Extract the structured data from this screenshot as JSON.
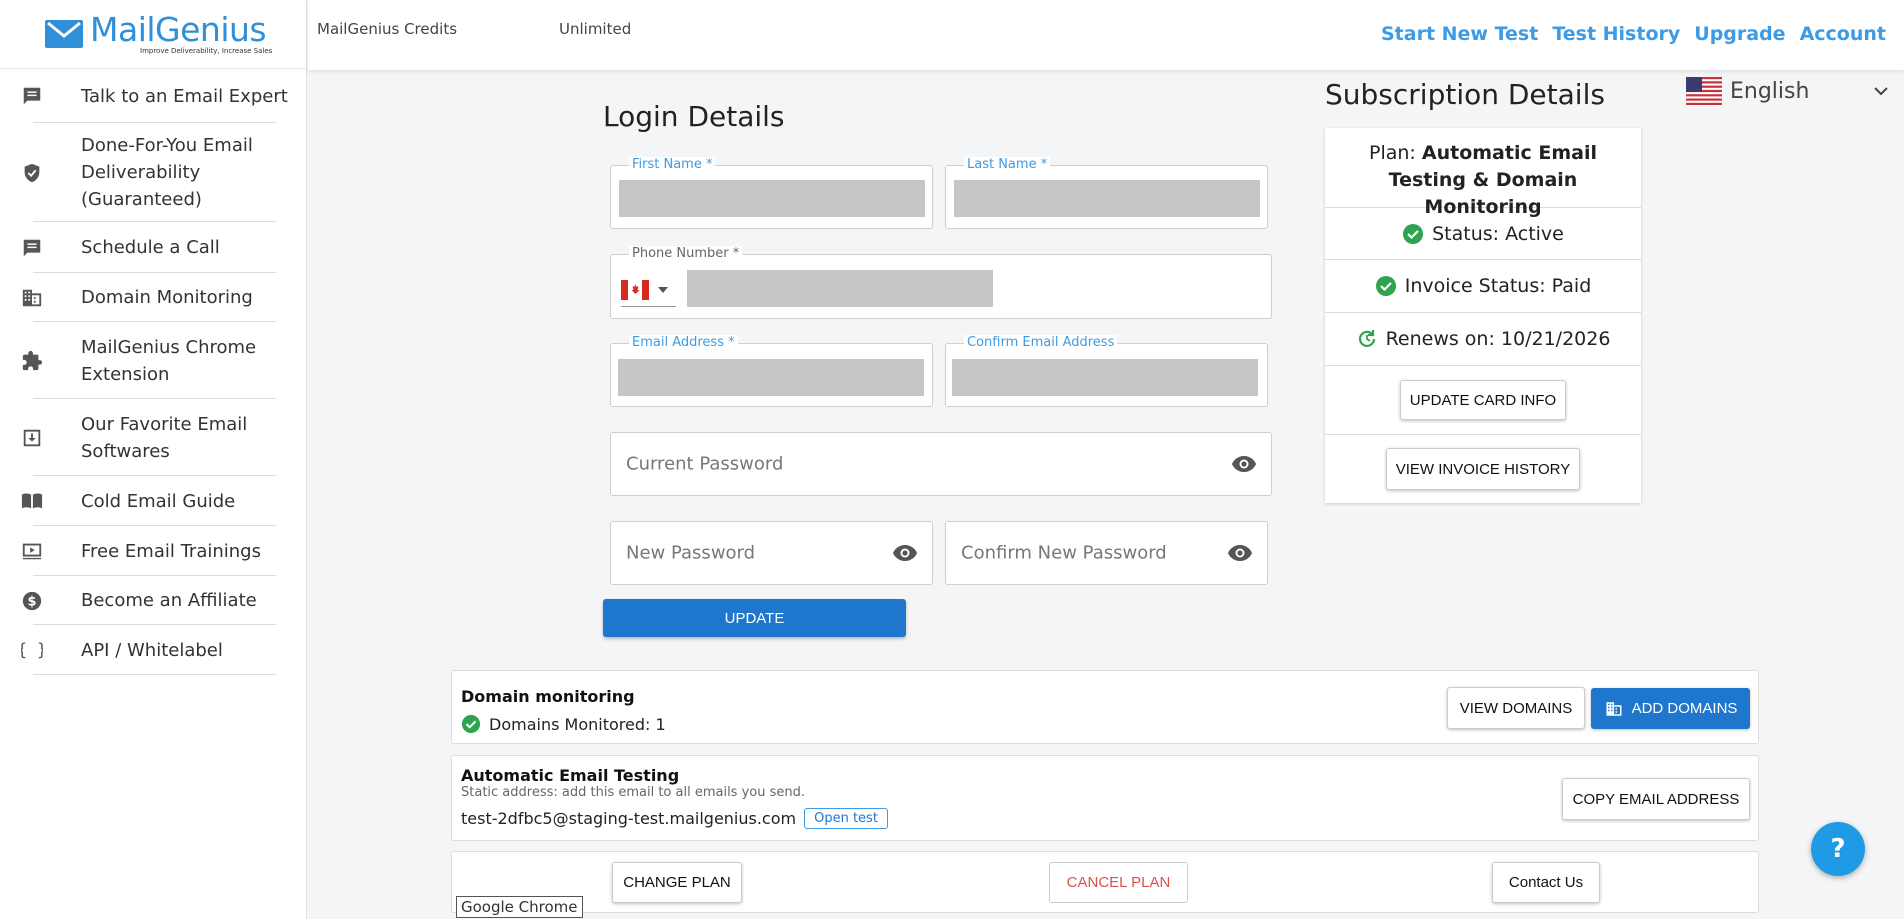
{
  "brand": {
    "name": "MailGenius",
    "tagline": "Improve Deliverability, Increase Sales",
    "color": "#2f8fd9"
  },
  "sidebar": {
    "items": [
      {
        "label": "Talk to an Email Expert",
        "icon": "chat-icon"
      },
      {
        "label": "Done-For-You Email Deliverability (Guaranteed)",
        "icon": "shield-check-icon"
      },
      {
        "label": "Schedule a Call",
        "icon": "chat-icon"
      },
      {
        "label": "Domain Monitoring",
        "icon": "building-icon"
      },
      {
        "label": "MailGenius Chrome Extension",
        "icon": "puzzle-icon"
      },
      {
        "label": "Our Favorite Email Softwares",
        "icon": "download-box-icon"
      },
      {
        "label": "Cold Email Guide",
        "icon": "book-icon"
      },
      {
        "label": "Free Email Trainings",
        "icon": "video-icon"
      },
      {
        "label": "Become an Affiliate",
        "icon": "dollar-icon"
      },
      {
        "label": "API / Whitelabel",
        "icon": "braces-icon"
      }
    ]
  },
  "topbar": {
    "credits_label": "MailGenius Credits",
    "credits_value": "Unlimited",
    "nav": [
      "Start New Test",
      "Test History",
      "Upgrade",
      "Account"
    ]
  },
  "login": {
    "title": "Login Details",
    "first_name_label": "First Name *",
    "last_name_label": "Last Name *",
    "phone_label": "Phone Number *",
    "email_label": "Email Address *",
    "confirm_email_label": "Confirm Email Address",
    "current_password_placeholder": "Current Password",
    "new_password_placeholder": "New Password",
    "confirm_new_password_placeholder": "Confirm New Password",
    "update_label": "UPDATE"
  },
  "language": {
    "selected": "English"
  },
  "subscription": {
    "title": "Subscription Details",
    "plan_label": "Plan:",
    "plan_name": "Automatic Email Testing & Domain Monitoring",
    "status": "Status: Active",
    "invoice_status": "Invoice Status: Paid",
    "renews": "Renews on: 10/21/2026",
    "update_card_label": "UPDATE CARD INFO",
    "invoice_history_label": "VIEW INVOICE HISTORY",
    "success_color": "#2ea44f"
  },
  "domain_monitoring": {
    "title": "Domain monitoring",
    "monitored": "Domains Monitored: 1",
    "view_label": "VIEW DOMAINS",
    "add_label": "ADD DOMAINS"
  },
  "auto_testing": {
    "title": "Automatic Email Testing",
    "subtitle": "Static address: add this email to all emails you send.",
    "address": "test-2dfbc5@staging-test.mailgenius.com",
    "open_test_label": "Open test",
    "copy_label": "COPY EMAIL ADDRESS"
  },
  "plan_actions": {
    "change_label": "CHANGE PLAN",
    "cancel_label": "CANCEL PLAN",
    "contact_label": "Contact Us",
    "cancel_color": "#d9534f"
  },
  "tooltip": "Google Chrome",
  "help": {
    "label": "?"
  }
}
